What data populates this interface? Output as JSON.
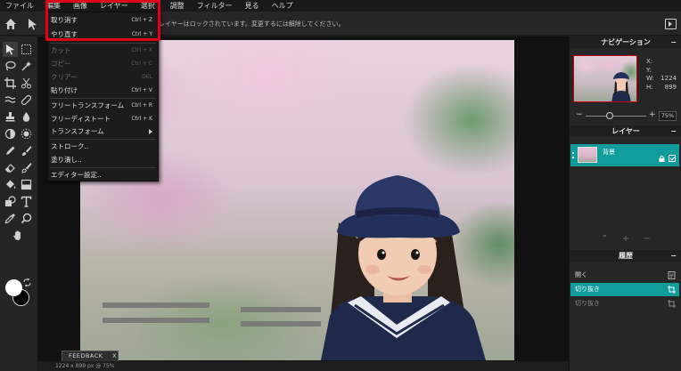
{
  "menu": {
    "items": [
      "ファイル",
      "編集",
      "画像",
      "レイヤー",
      "選択",
      "調整",
      "フィルター",
      "見る",
      "ヘルプ"
    ]
  },
  "optionbar": {
    "message": "レイヤーはロックされています。変更するには解除してください。"
  },
  "edit_menu": {
    "undo": {
      "label": "取り消す",
      "shortcut": "Ctrl + Z"
    },
    "redo": {
      "label": "やり直す",
      "shortcut": "Ctrl + Y"
    },
    "cut": {
      "label": "カット",
      "shortcut": "Ctrl + X"
    },
    "copy": {
      "label": "コピー",
      "shortcut": "Ctrl + C"
    },
    "clear": {
      "label": "クリアー",
      "shortcut": "DEL"
    },
    "paste": {
      "label": "貼り付け",
      "shortcut": "Ctrl + V"
    },
    "free_transform": {
      "label": "フリートランスフォーム",
      "shortcut": "Ctrl + R"
    },
    "free_distort": {
      "label": "フリーディストート",
      "shortcut": "Ctrl + K"
    },
    "transform": {
      "label": "トランスフォーム"
    },
    "stroke": {
      "label": "ストローク.."
    },
    "fill": {
      "label": "塗り潰し.."
    },
    "editor_settings": {
      "label": "エディター設定.."
    }
  },
  "navigation": {
    "title": "ナビゲーション",
    "x_label": "X:",
    "x_value": "",
    "y_label": "Y:",
    "y_value": "",
    "w_label": "W:",
    "w_value": "1224",
    "h_label": "H:",
    "h_value": "899",
    "zoom": "75%",
    "zoom_level": 0.75
  },
  "layers": {
    "title": "レイヤー",
    "items": [
      {
        "name": "背景"
      }
    ]
  },
  "history": {
    "title": "履歴",
    "items": [
      {
        "label": "開く"
      },
      {
        "label": "切り抜き"
      },
      {
        "label": "切り抜き"
      }
    ]
  },
  "feedback": {
    "label": "FEEDBACK",
    "close": "X"
  },
  "status": {
    "text": "1224 x 899 px @ 75%"
  },
  "colors": {
    "accent": "#119c9c",
    "highlight": "#e0001a",
    "foreground": "#ffffff",
    "background": "#000000"
  }
}
